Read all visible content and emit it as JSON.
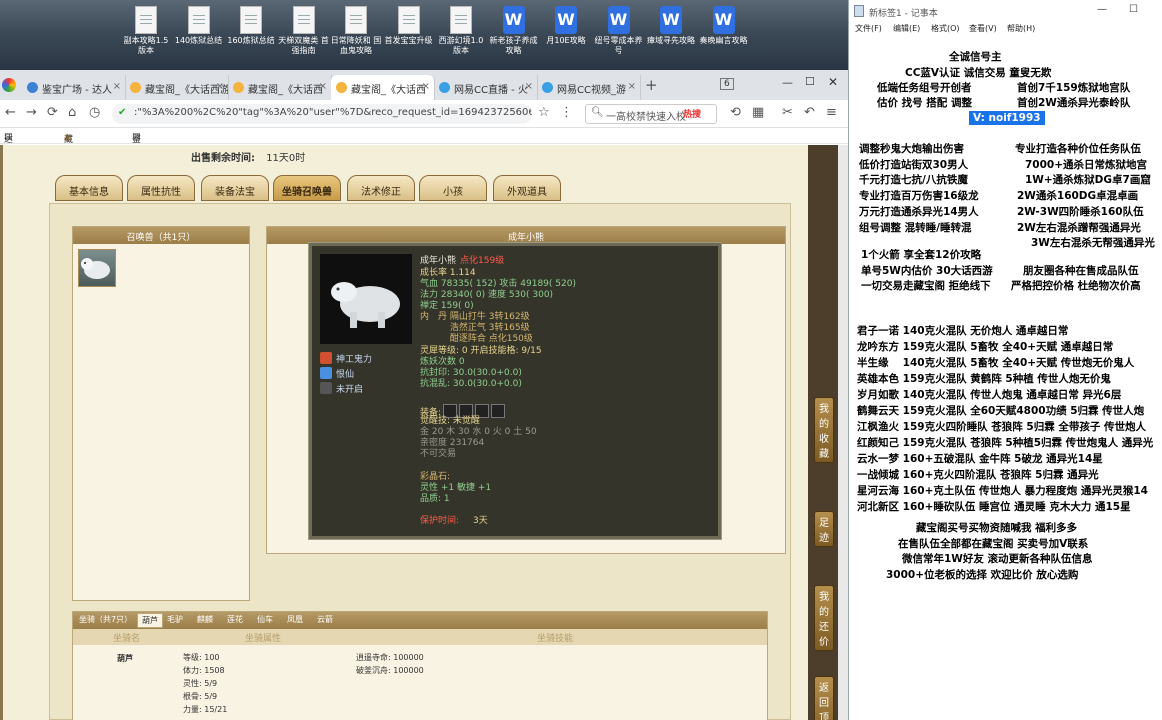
{
  "desktop": {
    "icons": [
      {
        "label": "副本攻略1.5版本",
        "type": "doc"
      },
      {
        "label": "140炼狱总结",
        "type": "doc"
      },
      {
        "label": "160炼狱总结",
        "type": "doc"
      },
      {
        "label": "天梯双魔类 首强指南",
        "type": "doc"
      },
      {
        "label": "日常降妖和 国血鬼攻略",
        "type": "doc"
      },
      {
        "label": "首发宝宝升级",
        "type": "doc"
      },
      {
        "label": "西游幻境1.0版本",
        "type": "doc"
      },
      {
        "label": "新老孩子养成攻略",
        "type": "wps"
      },
      {
        "label": "月10E攻略",
        "type": "wps"
      },
      {
        "label": "纽号零成本养号",
        "type": "wps"
      },
      {
        "label": "瘴域寻先攻略",
        "type": "wps"
      },
      {
        "label": "奏晚幽言攻略",
        "type": "wps"
      }
    ]
  },
  "browser": {
    "tabs": [
      {
        "label": "鉴宝广场 - 达人",
        "active": false
      },
      {
        "label": "藏宝阁_《大话西游",
        "active": false
      },
      {
        "label": "藏宝阁_《大话西",
        "active": false
      },
      {
        "label": "藏宝阁_《大话西",
        "active": true
      },
      {
        "label": "网易CC直播 - 火",
        "active": false
      },
      {
        "label": "网易CC视频_游",
        "active": false
      }
    ],
    "tab_count": "6",
    "url": ":\"%3A%200%2C%20\"tag\"%3A%20\"user\"%7D&reco_request_id=1694237256066ymjhH",
    "search_placeholder": "一高校禁快速入校",
    "hot_label": "热搜",
    "bookmarks": [
      "达人后台书",
      "藏宝阁_《",
      "鉴宝广场"
    ]
  },
  "game": {
    "sale_label": "出售剩余时间:",
    "sale_value": "11天0时",
    "tabs": [
      "基本信息",
      "属性抗性",
      "装备法宝",
      "坐骑召唤兽",
      "法术修正",
      "小孩",
      "外观道具"
    ],
    "active_tab": "坐骑召唤兽",
    "pet_list_title": "召唤兽（共1只）",
    "detail_title": "成年小熊",
    "pet": {
      "name_line": "成年小熊",
      "name_suffix": "点化159级",
      "growth": "成长率 1.114",
      "hp": "气血 78335( 152) 攻击 49189( 520)",
      "mp": "法力 28340( 0) 速度 530( 300)",
      "loyalty": "禅定 159( 0)",
      "dan1": "内　丹 隔山打牛 3转162级",
      "dan2": "　　　 浩然正气 3转165级",
      "dan3": "　　　 酣逐阵合 点化150级",
      "spirit": "灵犀等级: 0 开启技能格: 9/15",
      "refine": "炼妖次数 0",
      "resist1": "抗封印: 30.0(30.0+0.0)",
      "resist2": "抗混乱: 30.0(30.0+0.0)",
      "equip_label": "装备:",
      "awake": "觉醒技: 未觉醒",
      "elements": "金 20 木 30 水 0 火 0 土 50",
      "intimacy": "亲密度 231764",
      "trade": "不可交易",
      "stone_label": "彩晶石:",
      "stone1": "灵性 +1 敏捷 +1",
      "stone2": "品质: 1",
      "protect": "保护时间:",
      "protect_value": "3天"
    },
    "skills": [
      {
        "label": "神工鬼力",
        "color": "#d05030"
      },
      {
        "label": "恨仙",
        "color": "#4a90e2"
      },
      {
        "label": "未开启",
        "color": "#555555"
      }
    ],
    "mount": {
      "title": "坐骑（共7只）",
      "tabs": [
        "葫芦",
        "毛驴",
        "麒麟",
        "莲花",
        "仙车",
        "凤凰",
        "云箭"
      ],
      "head": [
        "坐骑名",
        "坐骑属性",
        "坐骑技能"
      ],
      "name": "葫芦",
      "attrs": [
        "等级: 100",
        "体力: 1508",
        "灵性: 5/9",
        "根骨: 5/9",
        "力量: 15/21"
      ],
      "skills": [
        "逍遥寺命: 100000",
        "破釜沉舟: 100000"
      ]
    },
    "side_buttons": [
      "我的收藏",
      "足迹",
      "我的还价",
      "返回顶部"
    ]
  },
  "notepad": {
    "title": "新标签1 - 记事本",
    "menu": [
      "文件(F)",
      "编辑(E)",
      "格式(O)",
      "查看(V)",
      "帮助(H)"
    ],
    "header_lines": [
      "全诚信号主",
      "CC蓝V认证 诚信交易 童叟无欺",
      "低端任务组号开创者",
      "首创7千159炼狱地宫队",
      "估价 找号 搭配 调整",
      "首创2W通杀异光泰岭队"
    ],
    "contact": "V: noif1993",
    "services": [
      [
        "调整秒鬼大炮输出伤害",
        "专业打造各种价位任务队伍"
      ],
      [
        "低价打造站街双30男人",
        "7000+通杀日常炼狱地宫"
      ],
      [
        "千元打造七抗/八抗铁魔",
        "1W+通杀炼狱DG卓7画窟"
      ],
      [
        "专业打造百万伤害16级龙",
        "2W通杀160DG卓混卓画"
      ],
      [
        "万元打造通杀异光14男人",
        "2W-3W四阶睡杀160队伍"
      ],
      [
        "组号调整 混转睡/睡转混",
        "2W左右混杀蹭帮强通异光"
      ],
      [
        "",
        "3W左右混杀无帮强通异光"
      ]
    ],
    "promo": [
      [
        "1个火箭 享全套12价攻略",
        ""
      ],
      [
        "单号5W内估价 30大话西游",
        "朋友圈各种在售成品队伍"
      ],
      [
        "一切交易走藏宝阁 拒绝线下",
        "严格把控价格 杜绝物次价高"
      ]
    ],
    "roster": [
      "君子一诺 140克火混队 无价炮人 通卓越日常",
      "龙吟东方 159克火混队 5畜牧 全40+天赋 通卓越日常",
      "半生缘　 140克火混队 5畜牧 全40+天赋 传世炮无价鬼人",
      "英雄本色 159克火混队 黄鹤阵 5种植 传世人炮无价鬼",
      "岁月如歌 140克火混队 传世人炮鬼 通卓越日常 异光6层",
      "鹤舞云天 159克火混队 全60天赋4800功绩 5归霖 传世人炮",
      "江枫渔火 159克火四阶睡队 苍狼阵 5归霖 全带孩子 传世炮人",
      "红颜知己 159克火混队 苍狼阵 5种植5归霖 传世炮鬼人 通异光",
      "云水一梦 160+五破混队 金牛阵 5破龙 通异光14星",
      "一战倾城 160+克火四阶混队 苍狼阵 5归霖 通异光",
      "星河云海 160+克土队伍 传世炮人 暴力程度炮 通异光灵猴14",
      "河北新区 160+睡砍队伍 睡宫位 通灵睡 克木大力 通15星"
    ],
    "footer": [
      "藏宝阁买号买物资随喊我 福利多多",
      "在售队伍全部都在藏宝阁 买卖号加V联系",
      "微信常年1W好友 滚动更新各种队伍信息",
      "3000+位老板的选择 欢迎比价 放心选购"
    ]
  }
}
